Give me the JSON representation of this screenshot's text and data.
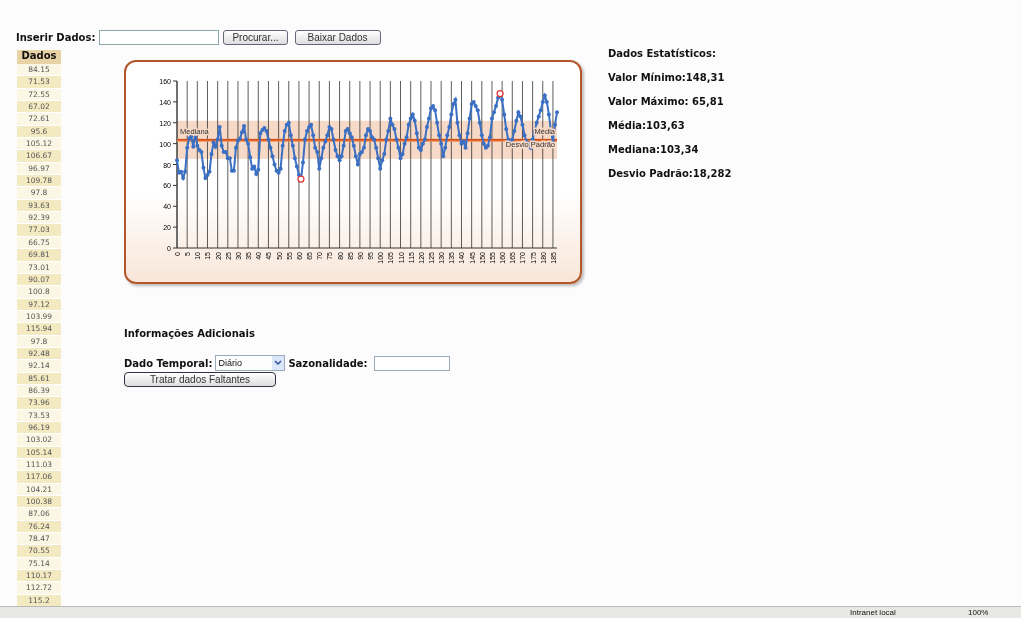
{
  "upload": {
    "label": "Inserir Dados:",
    "browse_button": "Procurar...",
    "download_button": "Baixar Dados"
  },
  "data_table": {
    "header": "Dados",
    "rows": [
      "84.15",
      "71.53",
      "72.55",
      "67.02",
      "72.61",
      "95.6",
      "105.12",
      "106.67",
      "96.97",
      "109.78",
      "97.8",
      "93.63",
      "92.39",
      "77.03",
      "66.75",
      "69.81",
      "73.01",
      "90.07",
      "100.8",
      "97.12",
      "103.99",
      "115.94",
      "97.8",
      "92.48",
      "92.14",
      "85.61",
      "86.39",
      "73.96",
      "73.53",
      "96.19",
      "103.02",
      "105.14",
      "111.03",
      "117.06",
      "104.21",
      "100.38",
      "87.06",
      "76.24",
      "78.47",
      "70.55",
      "75.14",
      "110.17",
      "112.72",
      "115.2"
    ]
  },
  "chart": {
    "chart_data": {
      "type": "line",
      "ylim": [
        0,
        160
      ],
      "xlim": [
        0,
        187
      ],
      "yticks": [
        0,
        20,
        40,
        60,
        80,
        100,
        120,
        140,
        160
      ],
      "xticks": [
        0,
        5,
        10,
        15,
        20,
        25,
        30,
        35,
        40,
        45,
        50,
        55,
        60,
        65,
        70,
        75,
        80,
        85,
        90,
        95,
        100,
        105,
        110,
        115,
        120,
        125,
        130,
        135,
        140,
        145,
        150,
        155,
        160,
        165,
        170,
        175,
        180,
        185
      ],
      "x": [
        0,
        1,
        2,
        3,
        4,
        5,
        6,
        7,
        8,
        9,
        10,
        11,
        12,
        13,
        14,
        15,
        16,
        17,
        18,
        19,
        20,
        21,
        22,
        23,
        24,
        25,
        26,
        27,
        28,
        29,
        30,
        31,
        32,
        33,
        34,
        35,
        36,
        37,
        38,
        39,
        40,
        41,
        42,
        43,
        44,
        45,
        46,
        47,
        48,
        49,
        50,
        51,
        52,
        53,
        54,
        55,
        56,
        57,
        58,
        59,
        60,
        61,
        62,
        63,
        64,
        65,
        66,
        67,
        68,
        69,
        70,
        71,
        72,
        73,
        74,
        75,
        76,
        77,
        78,
        79,
        80,
        81,
        82,
        83,
        84,
        85,
        86,
        87,
        88,
        89,
        90,
        91,
        92,
        93,
        94,
        95,
        96,
        97,
        98,
        99,
        100,
        101,
        102,
        103,
        104,
        105,
        106,
        107,
        108,
        109,
        110,
        111,
        112,
        113,
        114,
        115,
        116,
        117,
        118,
        119,
        120,
        121,
        122,
        123,
        124,
        125,
        126,
        127,
        128,
        129,
        130,
        131,
        132,
        133,
        134,
        135,
        136,
        137,
        138,
        139,
        140,
        141,
        142,
        143,
        144,
        145,
        146,
        147,
        148,
        149,
        150,
        151,
        152,
        153,
        154,
        155,
        156,
        157,
        158,
        159,
        160,
        161,
        162,
        163,
        164,
        165,
        166,
        167,
        168,
        169,
        170,
        171,
        172,
        173,
        174,
        175,
        176,
        177,
        178,
        179,
        180,
        181,
        182,
        183,
        184,
        185,
        186,
        187
      ],
      "series": [
        {
          "color": "#3a6fc4",
          "values": [
            84,
            72,
            73,
            67,
            73,
            96,
            105,
            107,
            97,
            110,
            98,
            94,
            92,
            77,
            67,
            70,
            73,
            90,
            101,
            97,
            104,
            116,
            98,
            92,
            92,
            86,
            86,
            74,
            74,
            96,
            103,
            105,
            111,
            117,
            104,
            100,
            87,
            76,
            78,
            71,
            75,
            110,
            113,
            115,
            112,
            104,
            96,
            88,
            80,
            74,
            72,
            76,
            98,
            112,
            118,
            120,
            108,
            98,
            86,
            78,
            70,
            66,
            82,
            104,
            112,
            116,
            118,
            108,
            96,
            92,
            76,
            86,
            96,
            102,
            108,
            116,
            114,
            104,
            94,
            88,
            84,
            88,
            98,
            112,
            114,
            110,
            106,
            98,
            88,
            80,
            90,
            92,
            96,
            108,
            114,
            112,
            106,
            104,
            96,
            86,
            76,
            84,
            90,
            104,
            112,
            124,
            118,
            114,
            104,
            96,
            86,
            90,
            100,
            106,
            118,
            124,
            128,
            122,
            110,
            96,
            94,
            100,
            104,
            116,
            124,
            134,
            136,
            132,
            120,
            108,
            100,
            88,
            96,
            108,
            116,
            128,
            138,
            142,
            120,
            108,
            100,
            102,
            96,
            110,
            124,
            138,
            140,
            136,
            132,
            120,
            108,
            100,
            96,
            98,
            106,
            124,
            130,
            136,
            144,
            148,
            142,
            128,
            114,
            104,
            100,
            104,
            112,
            122,
            130,
            126,
            118,
            108,
            102,
            100,
            96,
            104,
            112,
            120,
            126,
            132,
            140,
            146,
            140,
            128,
            112,
            102,
            118,
            130
          ]
        }
      ],
      "grid": true,
      "bands": [
        {
          "axis": "y",
          "from": 85.35,
          "to": 121.91,
          "label": "Desvio Padrão"
        }
      ],
      "ref_lines": [
        {
          "axis": "y",
          "value": 103.34,
          "label": "Mediana"
        },
        {
          "axis": "y",
          "value": 103.63,
          "label": "Média"
        }
      ]
    }
  },
  "statistics": {
    "title": "Dados Estatísticos:",
    "items": [
      "Valor Mínimo:148,31",
      "Valor Máximo: 65,81",
      "Média:103,63",
      "Mediana:103,34",
      "Desvio Padrão:18,282"
    ]
  },
  "additional_info": {
    "title": "Informações Adicionais",
    "temporal_label": "Dado Temporal:",
    "temporal_value": "Diário",
    "seasonality_label": "Sazonalidade:",
    "missing_button": "Tratar dados Faltantes"
  },
  "status_bar": {
    "zone": "Intranet local",
    "zoom": "100%"
  }
}
